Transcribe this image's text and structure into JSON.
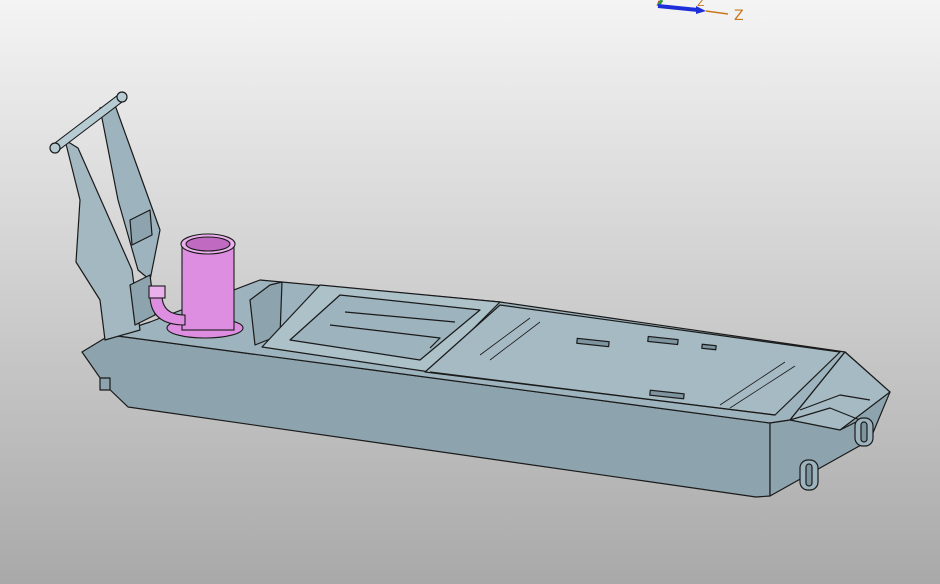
{
  "viewport": {
    "background_top": "#f4f4f4",
    "background_bottom": "#a9a9a9"
  },
  "colors": {
    "part_fill": "#9db3bd",
    "part_fill_light": "#b0c4cc",
    "part_fill_dark": "#7e95a0",
    "edge": "#1a1a1a",
    "highlight_part": "#de8ee0",
    "highlight_part_dark": "#c06ac2",
    "axis_x": "#d4262c",
    "axis_y": "#2ba33b",
    "axis_z": "#1d2fd8",
    "axis_label": "#c8781c"
  },
  "triad": {
    "z_label": "Z",
    "y_label": "Z"
  },
  "model": {
    "selected_part_icon": "pump-cylinder-icon"
  }
}
